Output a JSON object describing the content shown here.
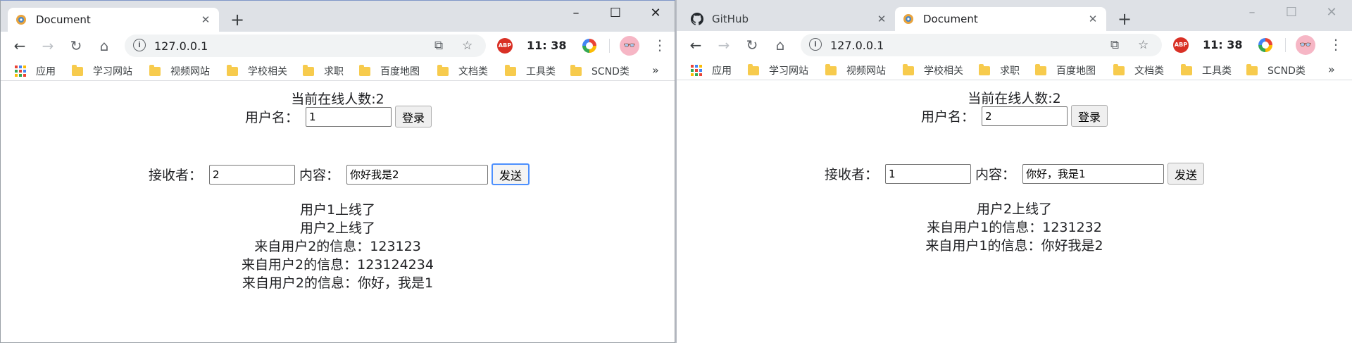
{
  "left": {
    "tab_title": "Document",
    "url": "127.0.0.1",
    "clock": "11:  38",
    "bookmarks": [
      "应用",
      "学习网站",
      "视频网站",
      "学校相关",
      "求职",
      "百度地图",
      "文档类",
      "工具类",
      "SCND类"
    ],
    "online": "当前在线人数:2",
    "username_label": "用户名：",
    "username_value": "1",
    "login_label": "登录",
    "receiver_label": "接收者：",
    "receiver_value": "2",
    "content_label": "内容：",
    "content_value": "你好我是2",
    "send_label": "发送",
    "messages": [
      "用户1上线了",
      "用户2上线了",
      "来自用户2的信息：123123",
      "来自用户2的信息：123124234",
      "来自用户2的信息：你好，我是1"
    ]
  },
  "right": {
    "tab1_title": "GitHub",
    "tab2_title": "Document",
    "url": "127.0.0.1",
    "clock": "11:  38",
    "bookmarks": [
      "应用",
      "学习网站",
      "视频网站",
      "学校相关",
      "求职",
      "百度地图",
      "文档类",
      "工具类",
      "SCND类"
    ],
    "online": "当前在线人数:2",
    "username_label": "用户名：",
    "username_value": "2",
    "login_label": "登录",
    "receiver_label": "接收者：",
    "receiver_value": "1",
    "content_label": "内容：",
    "content_value": "你好，我是1",
    "send_label": "发送",
    "messages": [
      "用户2上线了",
      "来自用户1的信息：1231232",
      "来自用户1的信息：你好我是2"
    ]
  },
  "icons": {
    "abp": "ABP",
    "more_bookmarks": "»"
  }
}
